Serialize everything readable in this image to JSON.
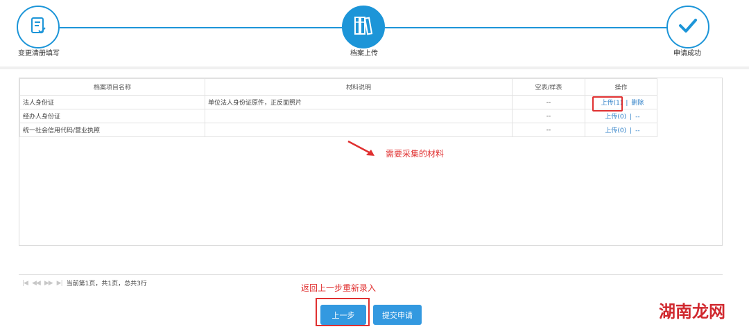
{
  "stepper": {
    "steps": [
      {
        "label": "变更清册填写",
        "icon": "form-edit-icon"
      },
      {
        "label": "档案上传",
        "icon": "archive-binders-icon"
      },
      {
        "label": "申请成功",
        "icon": "checkmark-icon"
      }
    ],
    "accent": "#1c95d8"
  },
  "table": {
    "headers": [
      "档案项目名称",
      "材料说明",
      "空表/样表",
      "操作"
    ],
    "rows": [
      {
        "name": "法人身份证",
        "desc": "单位法人身份证原件，正反面照片",
        "sample": "--",
        "upload": "上传(1)",
        "sep": "|",
        "action2": "删除"
      },
      {
        "name": "经办人身份证",
        "desc": "",
        "sample": "--",
        "upload": "上传(0)",
        "sep": "|",
        "action2": "--"
      },
      {
        "name": "统一社会信用代码/营业执照",
        "desc": "",
        "sample": "--",
        "upload": "上传(0)",
        "sep": "|",
        "action2": "--"
      }
    ]
  },
  "annotations": {
    "materials": "需要采集的材料",
    "back": "返回上一步重新录入"
  },
  "pager": {
    "info": "当前第1页，共1页，总共3行"
  },
  "buttons": {
    "prev": "上一步",
    "submit": "提交申请"
  },
  "watermark": "湖南龙网",
  "colors": {
    "annotation_red": "#e03030",
    "button_blue": "#3399e0",
    "link_blue": "#2d7fc7"
  }
}
